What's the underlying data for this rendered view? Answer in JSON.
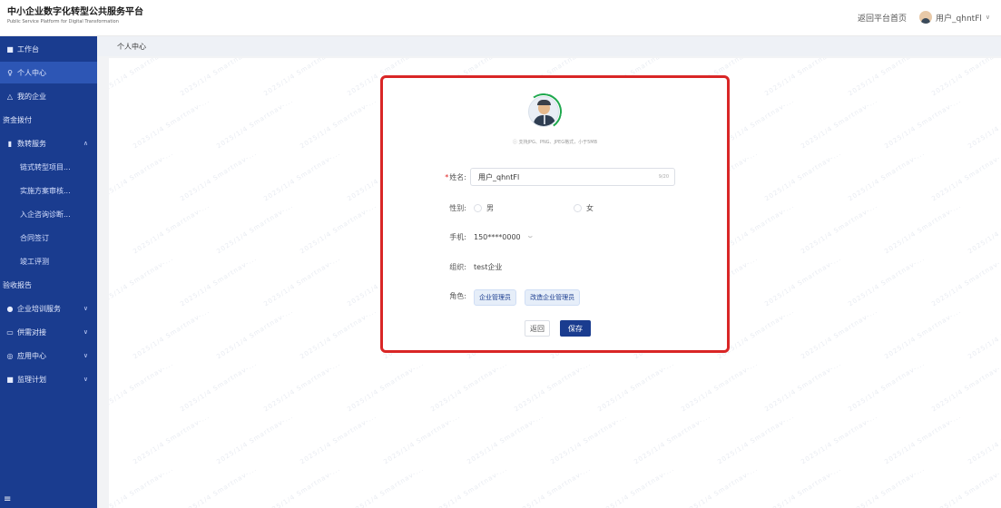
{
  "header": {
    "title": "中小企业数字化转型公共服务平台",
    "subtitle": "Public Service Platform for Digital Transformation",
    "home_link": "返回平台首页",
    "user_name": "用户_qhntFl"
  },
  "sidebar": {
    "items": [
      {
        "label": "工作台",
        "icon": "■"
      },
      {
        "label": "个人中心",
        "icon": "♀"
      },
      {
        "label": "我的企业",
        "icon": "△"
      },
      {
        "label": "资金拨付",
        "icon": ""
      },
      {
        "label": "数转服务",
        "icon": "▮"
      },
      {
        "label": "链式转型项目..."
      },
      {
        "label": "实施方案审核..."
      },
      {
        "label": "入企咨询诊断..."
      },
      {
        "label": "合同签订"
      },
      {
        "label": "竣工评测"
      },
      {
        "label": "验收报告"
      },
      {
        "label": "企业培训服务",
        "icon": "●"
      },
      {
        "label": "供需对接",
        "icon": "▭"
      },
      {
        "label": "应用中心",
        "icon": "◎"
      },
      {
        "label": "监理计划",
        "icon": "■"
      }
    ],
    "collapse_icon": "≡"
  },
  "breadcrumb": {
    "current": "个人中心"
  },
  "watermark": {
    "text": "2025/1/4 Smartnav-..."
  },
  "profile": {
    "avatar_hint": "ⓘ 支持JPG、PNG、JPEG格式，小于5MB",
    "name_label": "姓名:",
    "name_value": "用户_qhntFl",
    "name_counter": "9/20",
    "gender_label": "性别:",
    "gender_male": "男",
    "gender_female": "女",
    "phone_label": "手机:",
    "phone_value": "150****0000",
    "org_label": "组织:",
    "org_value": "test企业",
    "role_label": "角色:",
    "roles": [
      "企业管理员",
      "改造企业管理员"
    ],
    "back_button": "返回",
    "save_button": "保存"
  }
}
